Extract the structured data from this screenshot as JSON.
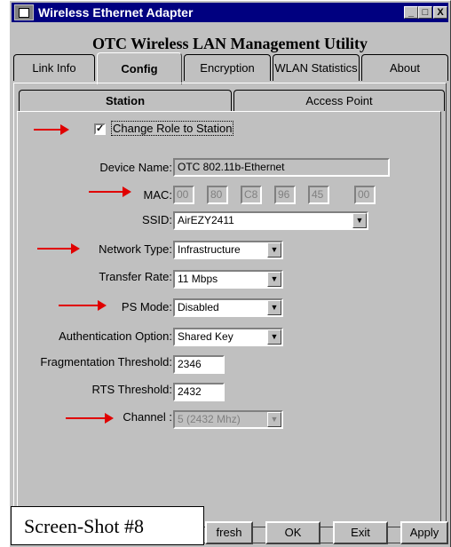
{
  "window": {
    "title": "Wireless Ethernet Adapter",
    "banner": "OTC Wireless LAN Management Utility",
    "minimize_symbol": "_",
    "maximize_symbol": "□",
    "close_symbol": "X"
  },
  "main_tabs": [
    {
      "label": "Link Info"
    },
    {
      "label": "Config"
    },
    {
      "label": "Encryption"
    },
    {
      "label": "WLAN Statistics"
    },
    {
      "label": "About"
    }
  ],
  "sub_tabs": [
    {
      "label": "Station"
    },
    {
      "label": "Access Point"
    }
  ],
  "change_role": {
    "label": "Change Role to Station",
    "checked_mark": "✓"
  },
  "device_name": {
    "label": "Device Name:",
    "value": "OTC 802.11b-Ethernet"
  },
  "mac": {
    "label": "MAC:",
    "octets": [
      "00",
      "80",
      "C8",
      "96",
      "45",
      "00"
    ]
  },
  "ssid": {
    "label": "SSID:",
    "value": "AirEZY2411"
  },
  "network_type": {
    "label": "Network Type:",
    "value": "Infrastructure"
  },
  "transfer_rate": {
    "label": "Transfer Rate:",
    "value": "11 Mbps"
  },
  "ps_mode": {
    "label": "PS Mode:",
    "value": "Disabled"
  },
  "auth_option": {
    "label": "Authentication Option:",
    "value": "Shared Key"
  },
  "frag_threshold": {
    "label": "Fragmentation Threshold:",
    "value": "2346"
  },
  "rts_threshold": {
    "label": "RTS Threshold:",
    "value": "2432"
  },
  "channel": {
    "label": "Channel :",
    "value": "5  (2432 Mhz)"
  },
  "buttons": {
    "refresh": "fresh",
    "ok": "OK",
    "exit": "Exit",
    "apply": "Apply"
  },
  "overlay_label": "Screen-Shot #8",
  "colors": {
    "window_bg": "#c0c0c0",
    "titlebar": "#000080",
    "arrow": "#e00000"
  },
  "icons": {
    "dropdown": "▼"
  }
}
